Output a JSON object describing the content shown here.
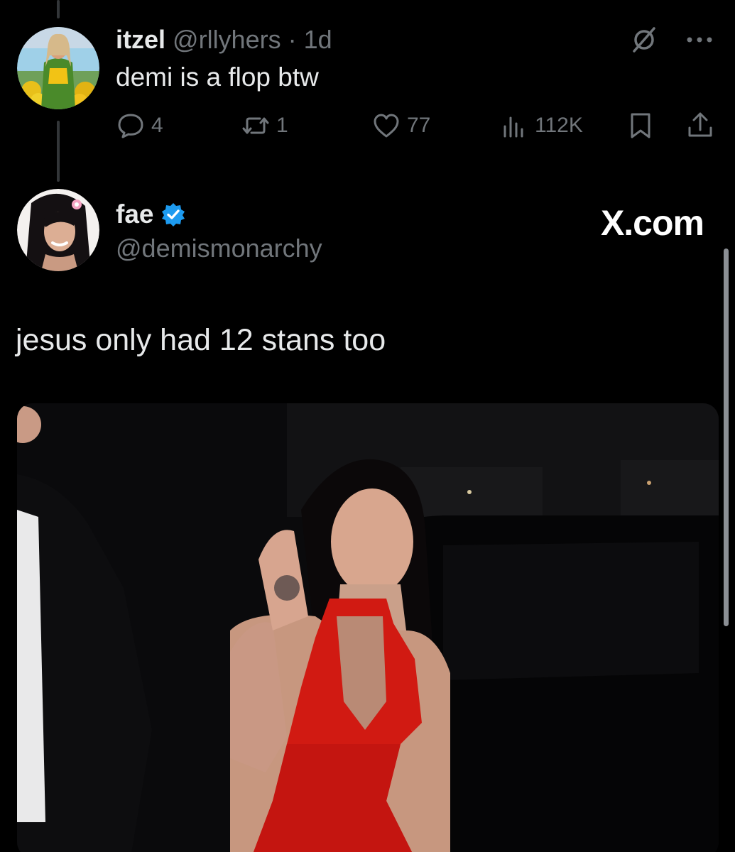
{
  "reply": {
    "name": "itzel",
    "handle": "@rllyhers",
    "time": "· 1d",
    "text": "demi is a flop btw",
    "icons": [
      "grok-icon",
      "more-icon"
    ],
    "actions": {
      "replies": "4",
      "reposts": "1",
      "likes": "77",
      "views": "112K"
    }
  },
  "tweet": {
    "name": "fae",
    "handle": "@demismonarchy",
    "verified": true,
    "text": "jesus only had 12 stans too",
    "source_badge": "X.com"
  },
  "colors": {
    "background": "#000000",
    "text_primary": "#e7e9ea",
    "text_secondary": "#71767b",
    "verified_blue": "#1d9bf0",
    "dress_red": "#d11a12"
  }
}
